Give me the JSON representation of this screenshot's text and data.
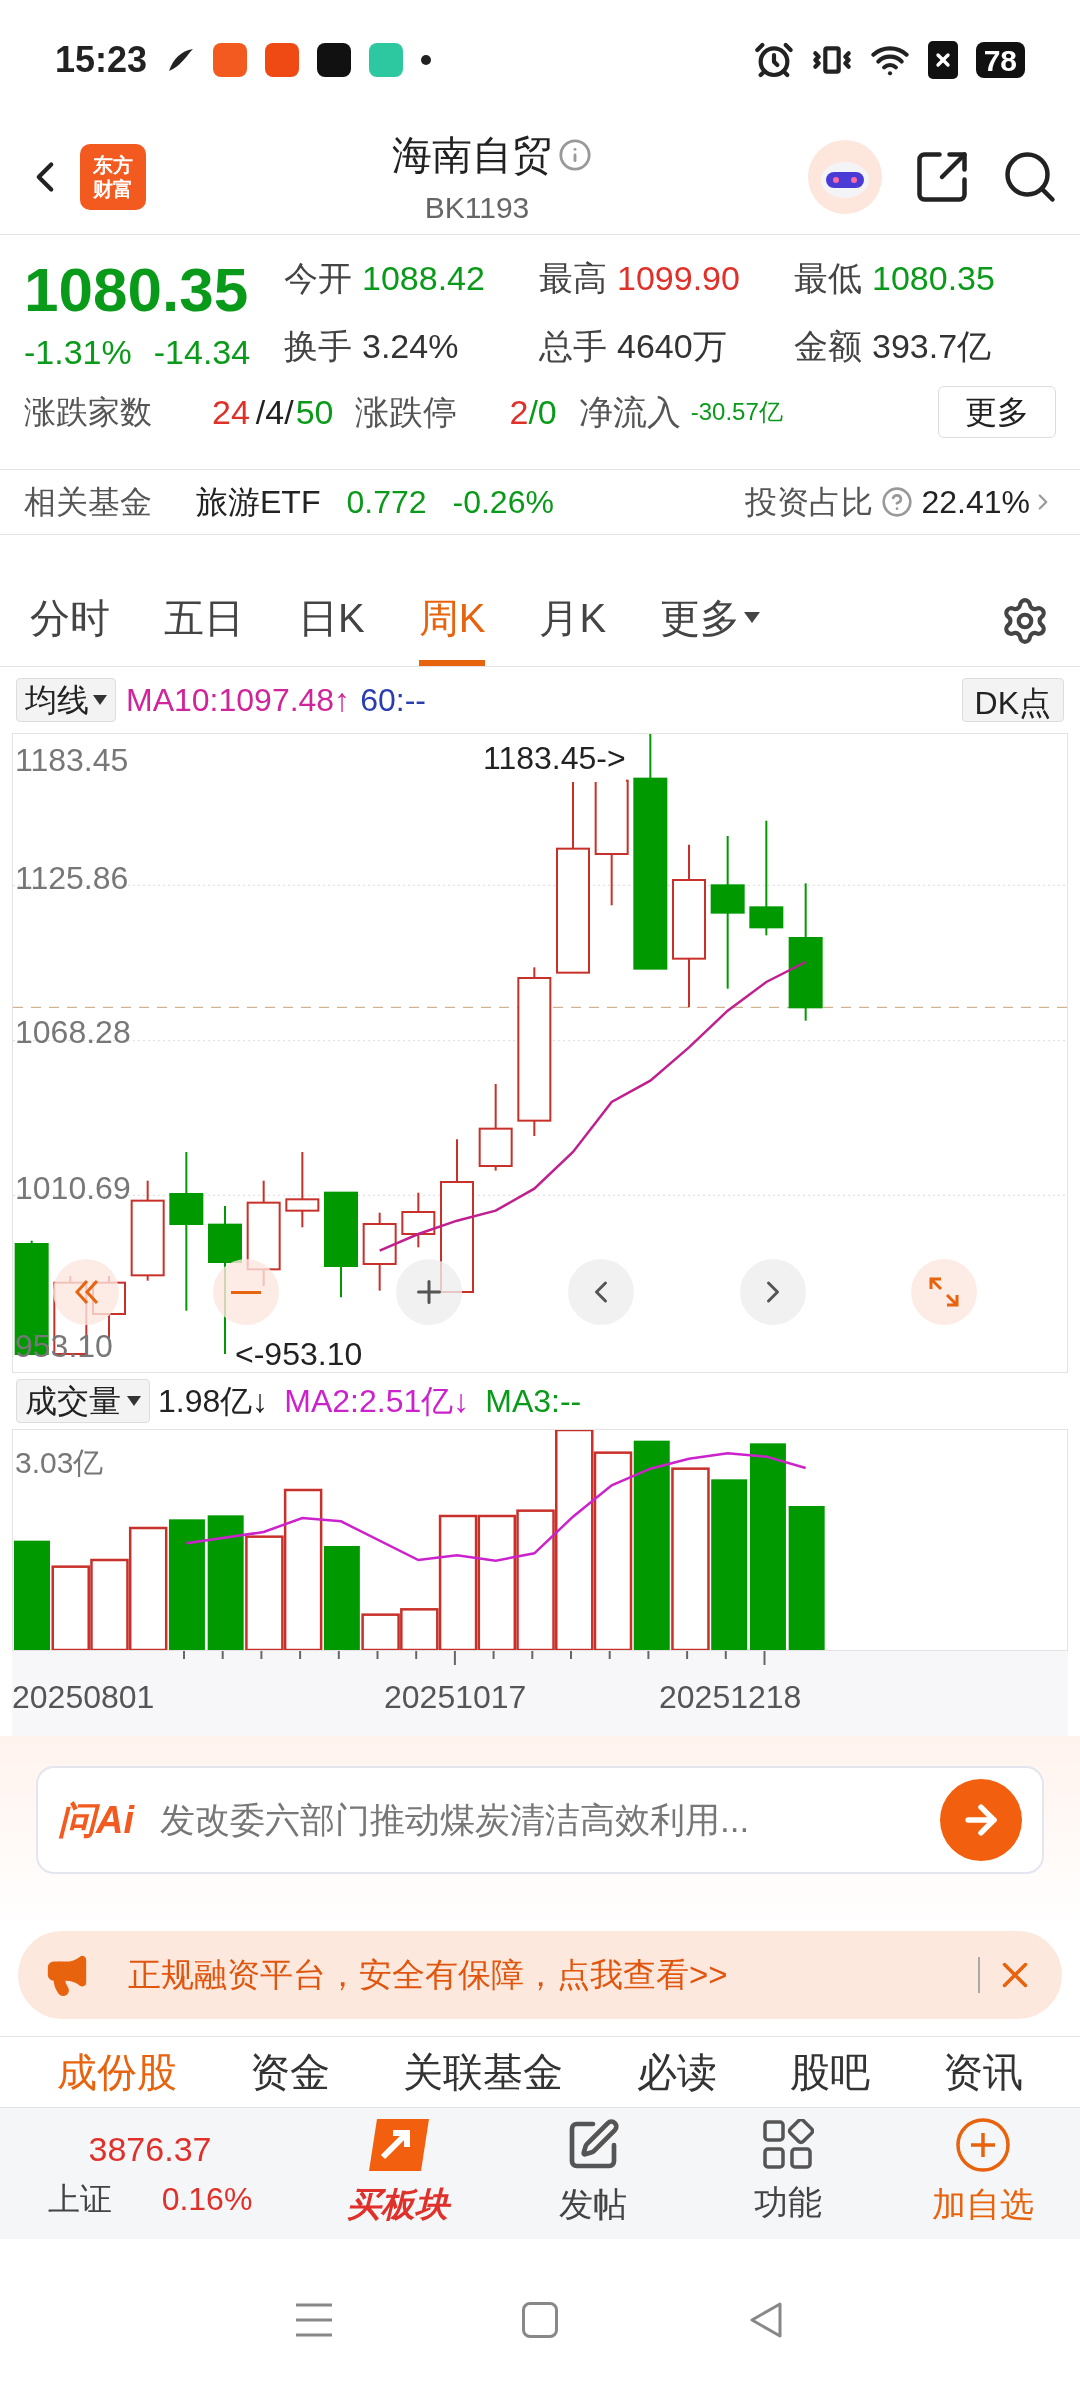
{
  "status_bar": {
    "time": "15:23",
    "battery": "78"
  },
  "header": {
    "logo_text": [
      "东方",
      "财富"
    ],
    "title": "海南自贸",
    "code": "BK1193"
  },
  "quote": {
    "price": "1080.35",
    "change_pct": "-1.31%",
    "change": "-14.34",
    "stats": [
      {
        "label": "今开",
        "value": "1088.42",
        "color": "#0a9a1a"
      },
      {
        "label": "最高",
        "value": "1099.90",
        "color": "#e0302a"
      },
      {
        "label": "最低",
        "value": "1080.35",
        "color": "#0a9a1a"
      },
      {
        "label": "换手",
        "value": "3.24%",
        "color": "#333333"
      },
      {
        "label": "总手",
        "value": "4640万",
        "color": "#333333"
      },
      {
        "label": "金额",
        "value": "393.7亿",
        "color": "#333333"
      }
    ],
    "breadth": {
      "label": "涨跌家数",
      "up": "24",
      "flat": "/4/",
      "down": "50"
    },
    "limit": {
      "label": "涨跌停",
      "up": "2",
      "down": "/0"
    },
    "net_inflow": {
      "label": "净流入",
      "value": "-30.57亿"
    },
    "more_button": "更多"
  },
  "fund": {
    "label": "相关基金",
    "name": "旅游ETF",
    "price": "0.772",
    "change": "-0.26%",
    "ratio_label": "投资占比",
    "ratio": "22.41%"
  },
  "chart_tabs": [
    {
      "label": "分时",
      "selected": false,
      "kind": "tab"
    },
    {
      "label": "五日",
      "selected": false,
      "kind": "tab"
    },
    {
      "label": "日K",
      "selected": false,
      "kind": "tab"
    },
    {
      "label": "周K",
      "selected": true,
      "kind": "tab"
    },
    {
      "label": "月K",
      "selected": false,
      "kind": "tab"
    },
    {
      "label": "更多",
      "selected": false,
      "kind": "dropdown"
    }
  ],
  "indicator": {
    "selector": "均线",
    "ma10": "MA10:1097.48↑",
    "ma60": "60:--",
    "dk_button": "DK点"
  },
  "price_axis": [
    "1183.45",
    "1125.86",
    "1068.28",
    "1010.69",
    "953.10"
  ],
  "high_marker": "1183.45->",
  "low_marker": "<-953.10",
  "volume": {
    "selector": "成交量",
    "value": "1.98亿↓",
    "ma2": "MA2:2.51亿↓",
    "ma3": "MA3:--",
    "axis_max": "3.03亿"
  },
  "dates": [
    "20250801",
    "20251017",
    "20251218"
  ],
  "ai": {
    "brand": "问Ai",
    "text": "发改委六部门推动煤炭清洁高效利用..."
  },
  "ad": {
    "text": "正规融资平台，安全有保障，点我查看>>"
  },
  "section_tabs": [
    {
      "label": "成份股",
      "selected": true
    },
    {
      "label": "资金",
      "selected": false
    },
    {
      "label": "关联基金",
      "selected": false
    },
    {
      "label": "必读",
      "selected": false
    },
    {
      "label": "股吧",
      "selected": false
    },
    {
      "label": "资讯",
      "selected": false
    }
  ],
  "bottom_bar": {
    "index_value": "3876.37",
    "index_name": "上证",
    "index_change": "0.16%",
    "actions": [
      {
        "label": "买板块",
        "kind": "featured"
      },
      {
        "label": "发帖",
        "kind": "post"
      },
      {
        "label": "功能",
        "kind": "grid"
      },
      {
        "label": "加自选",
        "kind": "add"
      }
    ]
  }
}
